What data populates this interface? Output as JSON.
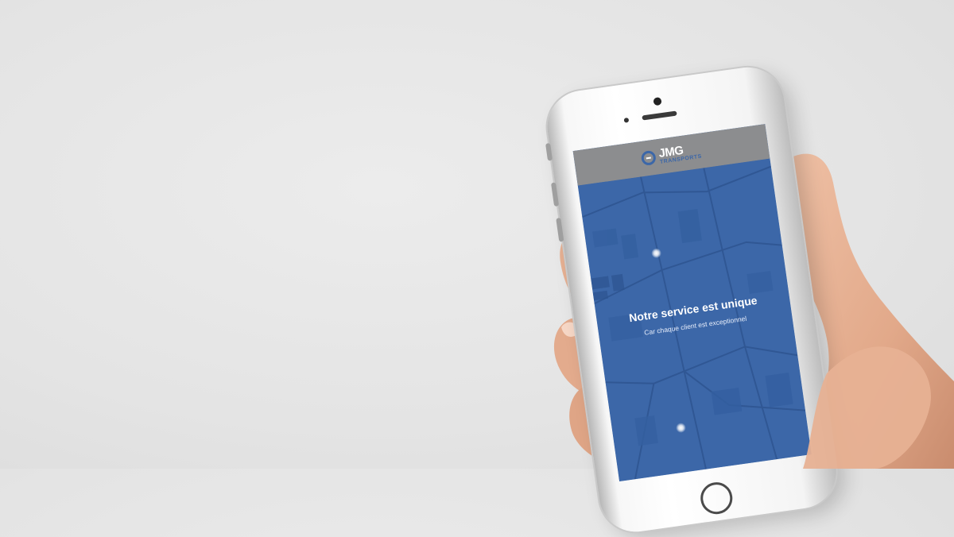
{
  "colors": {
    "background": "#e6e6e6",
    "accent_blue": "#3c67a8",
    "header_gray": "#8c8d8f",
    "skin": "#e9b597"
  },
  "app": {
    "logo": {
      "icon": "jmg-logo-icon",
      "name": "JMG",
      "subtitle": "TRANSPORTS"
    },
    "hero": {
      "title": "Notre service est unique",
      "subtitle": "Car chaque client est exceptionnel"
    },
    "map_markers": 2
  }
}
